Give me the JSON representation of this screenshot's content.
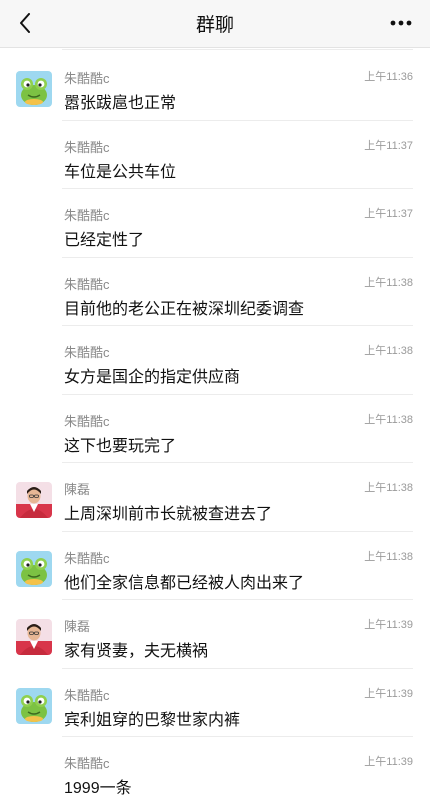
{
  "header": {
    "title": "群聊"
  },
  "messages": [
    {
      "sender": "朱酷酷c",
      "time": "上午11:36",
      "text": "嚣张跋扈也正常",
      "avatar": "frog"
    },
    {
      "sender": "朱酷酷c",
      "time": "上午11:37",
      "text": "车位是公共车位",
      "avatar": ""
    },
    {
      "sender": "朱酷酷c",
      "time": "上午11:37",
      "text": "已经定性了",
      "avatar": ""
    },
    {
      "sender": "朱酷酷c",
      "time": "上午11:38",
      "text": "目前他的老公正在被深圳纪委调查",
      "avatar": ""
    },
    {
      "sender": "朱酷酷c",
      "time": "上午11:38",
      "text": "女方是国企的指定供应商",
      "avatar": ""
    },
    {
      "sender": "朱酷酷c",
      "time": "上午11:38",
      "text": "这下也要玩完了",
      "avatar": ""
    },
    {
      "sender": "陳磊",
      "time": "上午11:38",
      "text": "上周深圳前市长就被查进去了",
      "avatar": "person"
    },
    {
      "sender": "朱酷酷c",
      "time": "上午11:38",
      "text": "他们全家信息都已经被人肉出来了",
      "avatar": "frog"
    },
    {
      "sender": "陳磊",
      "time": "上午11:39",
      "text": "家有贤妻，夫无横祸",
      "avatar": "person"
    },
    {
      "sender": "朱酷酷c",
      "time": "上午11:39",
      "text": "宾利姐穿的巴黎世家内裤",
      "avatar": "frog"
    },
    {
      "sender": "朱酷酷c",
      "time": "上午11:39",
      "text": "1999一条",
      "avatar": ""
    }
  ]
}
